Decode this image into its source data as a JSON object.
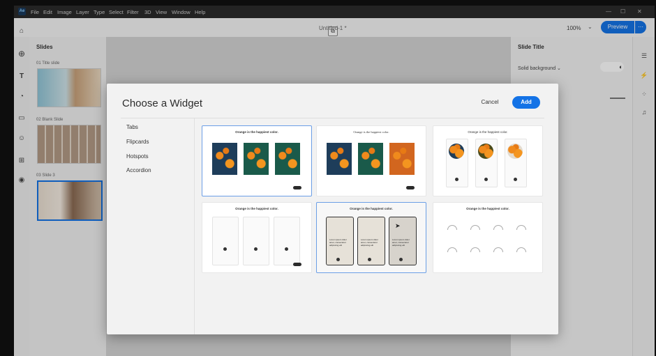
{
  "menubar": {
    "logo_text": "Ae",
    "items": [
      "File",
      "Edit",
      "Image",
      "Layer",
      "Type",
      "Select",
      "Filter",
      "3D",
      "View",
      "Window",
      "Help"
    ],
    "window_controls": [
      "—",
      "☐",
      "✕"
    ]
  },
  "topbar": {
    "doc_title": "Untitled-1 *",
    "zoom": "100%",
    "preview_label": "Preview",
    "more_label": "⋯"
  },
  "slides": {
    "title": "Slides",
    "items": [
      {
        "label": "01  Title slide"
      },
      {
        "label": "02  Blank Slide"
      },
      {
        "label": "03  Slide 3"
      }
    ]
  },
  "right_panel": {
    "title": "Slide Title",
    "background_label": "Solid background"
  },
  "modal": {
    "title": "Choose a Widget",
    "cancel_label": "Cancel",
    "add_label": "Add",
    "categories": [
      "Tabs",
      "Flipcards",
      "Hotspots",
      "Accordion"
    ],
    "card_title": "Orange is the happiest color.",
    "flip_text": "Lorem ipsum dolor amet, consectetur adipiscing elit"
  },
  "colors": {
    "accent": "#1473e6",
    "selected_border": "#6b9ee6"
  }
}
